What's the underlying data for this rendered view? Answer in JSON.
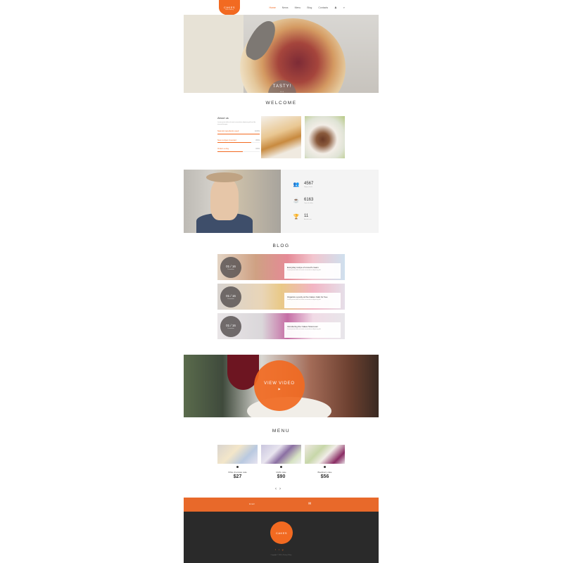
{
  "header": {
    "logo_text": "CAKES",
    "logo_sub": "sweet bakery",
    "nav": [
      "Home",
      "News",
      "Menu",
      "Blog",
      "Contacts"
    ],
    "active_nav": "Home"
  },
  "hero": {
    "caption": "TASTY!",
    "dots": "•••"
  },
  "welcome": {
    "title": "WELCOME",
    "about_title": "About us",
    "about_text": "Lorem ipsum dolor sit amet consectetur adipiscing elit sed do eiusmod tempor.",
    "skills": [
      {
        "label": "Natural ingredients used",
        "pct": "100%",
        "fill": 1.0
      },
      {
        "label": "New recipes invented",
        "pct": "80%",
        "fill": 0.8
      },
      {
        "label": "Orders a day",
        "pct": "60%",
        "fill": 0.6
      }
    ]
  },
  "stats": [
    {
      "icon": "people-icon",
      "glyph": "👥",
      "value": "4567",
      "label": "Happy clients"
    },
    {
      "icon": "coffee-cup-icon",
      "glyph": "☕",
      "value": "6163",
      "label": "Cups of coffee"
    },
    {
      "icon": "trophy-icon",
      "glyph": "🏆",
      "value": "11",
      "label": "Awards won"
    }
  ],
  "blog": {
    "title": "BLOG",
    "posts": [
      {
        "day": "01 / 16",
        "month": "December",
        "title": "Everyday recipe of smooth cream",
        "excerpt": "Lorem ipsum dolor sit amet consectetur adipiscing elit."
      },
      {
        "day": "01 / 16",
        "month": "December",
        "title": "Organize a party at the Cakes Café for free",
        "excerpt": "Lorem ipsum dolor sit amet consectetur adipiscing elit."
      },
      {
        "day": "01 / 16",
        "month": "December",
        "title": "Introducing the Cakes Storeroom",
        "excerpt": "Lorem ipsum dolor sit amet consectetur adipiscing elit."
      }
    ]
  },
  "video": {
    "label": "VIEW VIDEO",
    "play": "▶"
  },
  "menu": {
    "title": "MENU",
    "items": [
      {
        "name": "White chocolate cake",
        "price": "$27"
      },
      {
        "name": "Muffin cake",
        "price": "$90"
      },
      {
        "name": "Blackberry cake",
        "price": "$56"
      }
    ],
    "prev": "‹",
    "next": "›"
  },
  "subscribe": {
    "label": "Email",
    "icon": "mail-icon"
  },
  "footer": {
    "logo_text": "CAKES",
    "socials": [
      "f",
      "t",
      "g"
    ],
    "copyright": "Copyright © 2016 | Privacy Policy"
  },
  "colors": {
    "accent": "#f26a21",
    "footer_bg": "#2a2a2a",
    "stats_bg": "#f4f4f4"
  }
}
